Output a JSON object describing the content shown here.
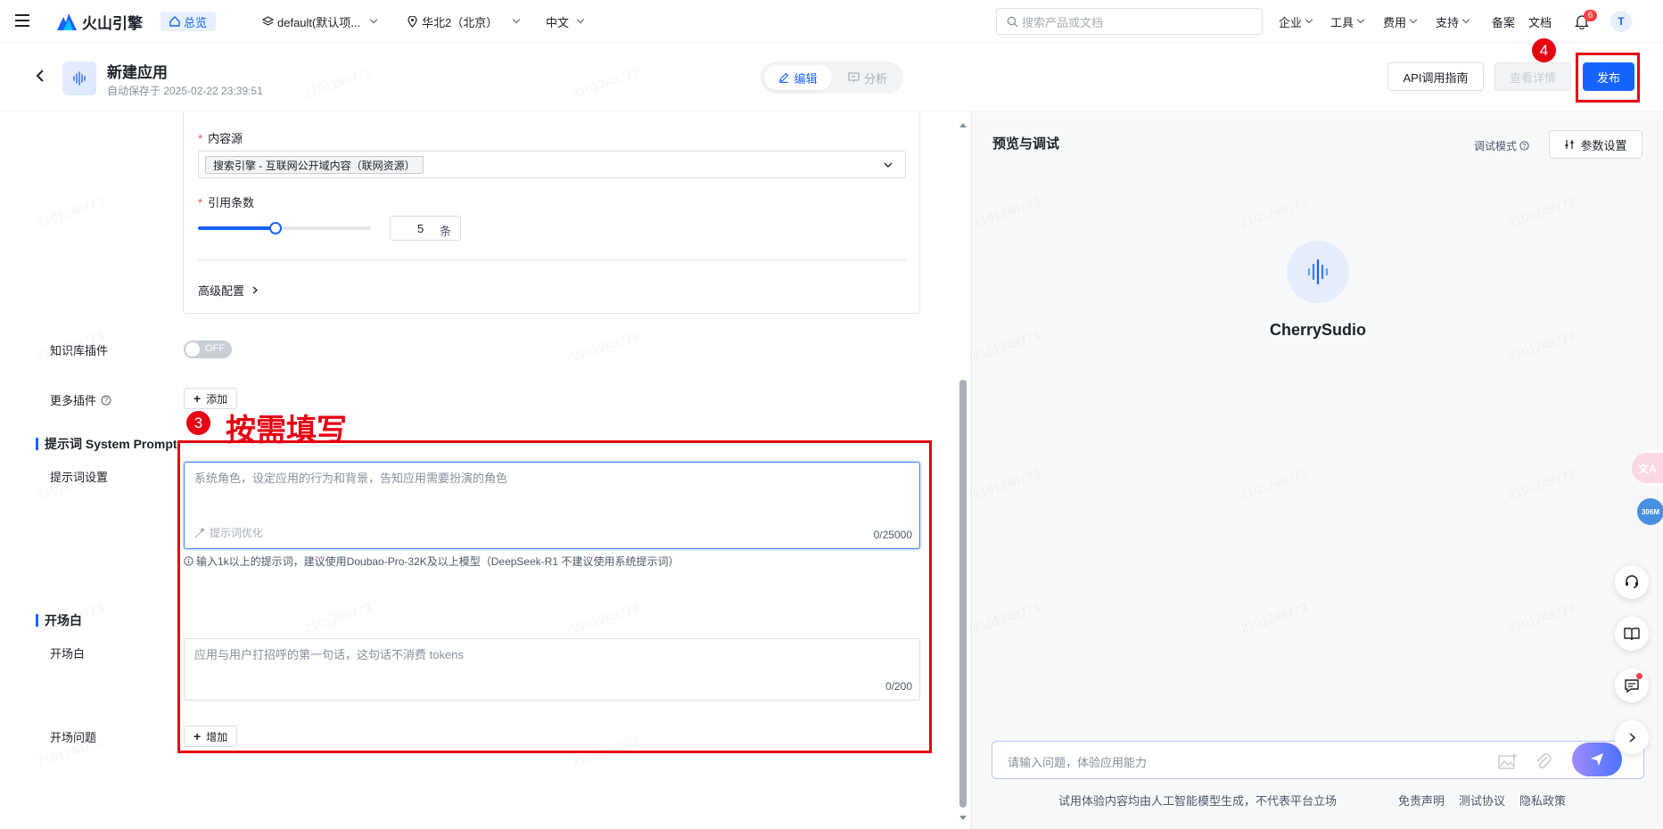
{
  "nav": {
    "brand": "火山引擎",
    "overview": "总览",
    "project": "default(默认项...",
    "region": "华北2（北京）",
    "language": "中文",
    "search_placeholder": "搜索产品或文档",
    "menu": [
      "企业",
      "工具",
      "费用",
      "支持"
    ],
    "links": [
      "备案",
      "文档"
    ],
    "notification_count": "6",
    "avatar": "T"
  },
  "header": {
    "title": "新建应用",
    "autosave": "自动保存于 2025-02-22 23:39:51",
    "tabs": [
      "编辑",
      "分析"
    ],
    "api_guide": "API调用指南",
    "view_details": "查看详情",
    "publish": "发布"
  },
  "form": {
    "content_source_label": "内容源",
    "content_source_value": "搜索引擎 - 互联网公开域内容（联网资源）",
    "citation_label": "引用条数",
    "citation_value": "5",
    "citation_unit": "条",
    "citation_slider_fraction": 0.45,
    "advanced": "高级配置",
    "kb_plugin_label": "知识库插件",
    "kb_plugin_state": "OFF",
    "more_plugins_label": "更多插件",
    "add_label": "添加",
    "prompt_section": "提示词 System Prompt",
    "prompt_label": "提示词设置",
    "prompt_placeholder": "系统角色，设定应用的行为和背景，告知应用需要扮演的角色",
    "prompt_optimize": "提示词优化",
    "prompt_counter": "0/25000",
    "prompt_hint": "输入1k以上的提示词，建议使用Doubao-Pro-32K及以上模型（DeepSeek-R1 不建议使用系统提示词）",
    "opening_section": "开场白",
    "opening_label": "开场白",
    "opening_placeholder": "应用与用户打招呼的第一句话，这句话不消费 tokens",
    "opening_counter": "0/200",
    "opening_questions_label": "开场问题",
    "increase_label": "增加"
  },
  "annotations": {
    "step3": "3",
    "step3_text": "按需填写",
    "step4": "4"
  },
  "preview": {
    "title": "预览与调试",
    "debug_mode": "调试模式",
    "param_settings": "参数设置",
    "app_name": "CherrySudio",
    "input_placeholder": "请输入问题，体验应用能力",
    "disclaimer": "试用体验内容均由人工智能模型生成，不代表平台立场",
    "footer_links": [
      "免责声明",
      "测试协议",
      "隐私政策"
    ],
    "side_badge": "306M"
  },
  "watermark_text": "2101248773",
  "colors": {
    "primary": "#1664ff",
    "annotation_red": "#e60012"
  }
}
